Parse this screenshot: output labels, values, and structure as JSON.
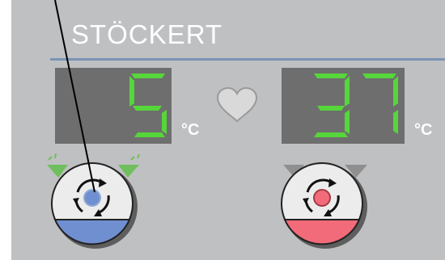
{
  "brand": {
    "name": "STÖCKERT"
  },
  "left_channel": {
    "value": "5",
    "unit": "°C",
    "button_color": "#6f8fd0",
    "indicator_color": "#6fbf5e"
  },
  "right_channel": {
    "value": "37",
    "unit": "°C",
    "button_color": "#f26b7a",
    "indicator_color": "#8f8f8f"
  },
  "colors": {
    "panel": "#bfc0c2",
    "display_bg": "#6e6e6e",
    "segment_on": "#56d63a",
    "segment_off": "#777777",
    "brand_line": "#7b93b7"
  },
  "icons": {
    "heart": "heart-icon",
    "rotate": "rotate-arrows-icon"
  }
}
